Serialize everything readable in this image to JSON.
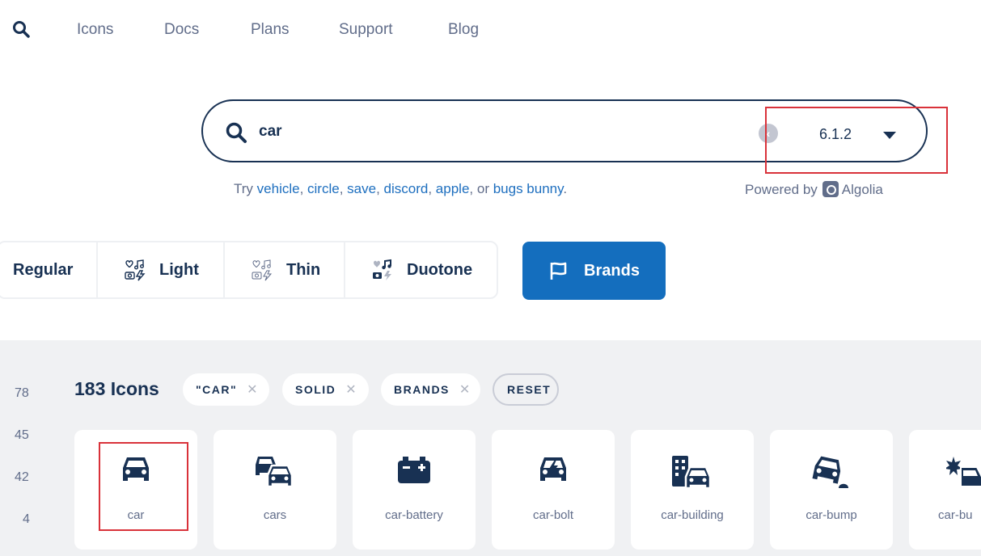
{
  "nav": {
    "search_icon": "magnifying-glass-icon",
    "links": [
      "Icons",
      "Docs",
      "Plans",
      "Support",
      "Blog"
    ]
  },
  "search": {
    "value": "car",
    "clear_icon": "chevron-left-circle-icon",
    "version": "6.1.2",
    "suggestions_prefix": "Try",
    "suggestions": [
      "vehicle",
      "circle",
      "save",
      "discord",
      "apple",
      "bugs bunny"
    ],
    "suggestions_or": "or",
    "powered_by": "Powered by",
    "powered_brand": "Algolia"
  },
  "styles": {
    "tabs": [
      "Regular",
      "Light",
      "Thin",
      "Duotone"
    ],
    "brands": "Brands",
    "active": "Brands"
  },
  "results": {
    "side_numbers": [
      "78",
      "45",
      "42",
      "4"
    ],
    "count_label": "183 Icons",
    "filters": [
      "\"CAR\"",
      "SOLID",
      "BRANDS"
    ],
    "reset": "RESET",
    "icons": [
      "car",
      "cars",
      "car-battery",
      "car-bolt",
      "car-building",
      "car-bump",
      "car-bu"
    ]
  },
  "colors": {
    "primary": "#183153",
    "accent": "#146ebe",
    "muted": "#616d8a",
    "highlight": "#d9323a"
  }
}
